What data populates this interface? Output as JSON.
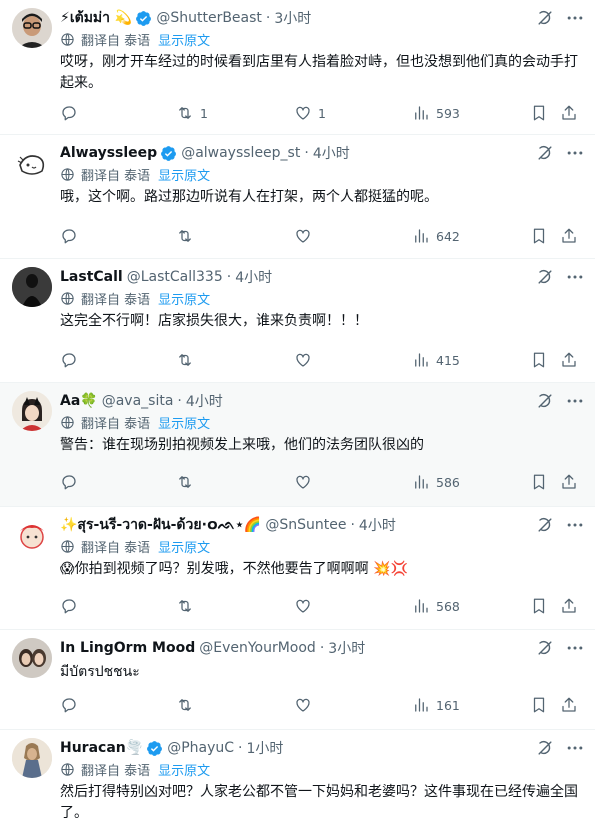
{
  "translation": {
    "label": "翻译自 泰语",
    "show_original": "显示原文"
  },
  "tweets": [
    {
      "name": "⚡เต้มม่า 💫",
      "handle": "@ShutterBeast",
      "time": "3小时",
      "text": "哎呀，刚才开车经过的时候看到店里有人指着脸对峙，但也没想到他们真的会动手打起来。",
      "replies": "",
      "retweets": "1",
      "likes": "1",
      "views": "593",
      "verified": true
    },
    {
      "name": "Alwayssleep",
      "handle": "@alwayssleep_st",
      "time": "4小时",
      "text": "哦，这个啊。路过那边听说有人在打架，两个人都挺猛的呢。",
      "replies": "",
      "retweets": "",
      "likes": "",
      "views": "642",
      "verified": true
    },
    {
      "name": "LastCall",
      "handle": "@LastCall335",
      "time": "4小时",
      "text": "这完全不行啊！店家损失很大，谁来负责啊！！！",
      "replies": "",
      "retweets": "",
      "likes": "",
      "views": "415",
      "verified": false
    },
    {
      "name": "Aa🍀",
      "handle": "@ava_sita",
      "time": "4小时",
      "text": "警告：谁在现场别拍视频发上来哦，他们的法务团队很凶的",
      "replies": "",
      "retweets": "",
      "likes": "",
      "views": "586",
      "verified": false
    },
    {
      "name": "✨สุร-นรี-วาด-ฝัน-ด้วย·໐ᨒ⋆🌈",
      "handle": "@SnSuntee",
      "time": "4小时",
      "text": "😱你拍到视频了吗？别发哦，不然他要告了啊啊啊 💥💢",
      "replies": "",
      "retweets": "",
      "likes": "",
      "views": "568",
      "verified": false
    },
    {
      "name": "In LingOrm Mood",
      "handle": "@EvenYourMood",
      "time": "3小时",
      "text": "มีบัตรปชชนะ",
      "replies": "",
      "retweets": "",
      "likes": "",
      "views": "161",
      "verified": false
    },
    {
      "name": "Huracan🌪️",
      "handle": "@PhayuC",
      "time": "1小时",
      "text": "然后打得特别凶对吧？人家老公都不管一下妈妈和老婆吗？这件事现在已经传遍全国了。",
      "replies": "",
      "retweets": "",
      "likes": "",
      "views": "",
      "verified": true
    }
  ]
}
